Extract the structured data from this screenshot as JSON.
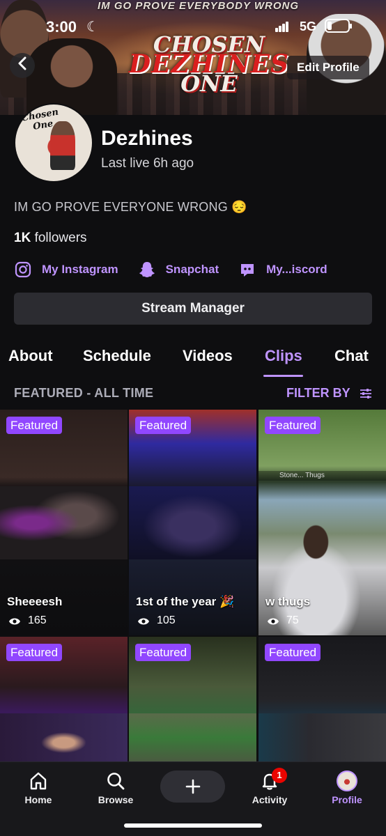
{
  "status_bar": {
    "time": "3:00",
    "network": "5G"
  },
  "banner": {
    "top_text": "IM GO PROVE EVERYBODY WRONG",
    "logo_line1": "CHOSEN",
    "logo_line2": "DEZHINES",
    "logo_line3": "ONE"
  },
  "header": {
    "edit_profile_label": "Edit Profile"
  },
  "profile": {
    "avatar_text_line1": "Chosen",
    "avatar_text_line2": "One",
    "username": "Dezhines",
    "last_live": "Last live 6h ago",
    "bio": "IM GO PROVE EVERYONE WRONG 😔",
    "followers_count": "1K",
    "followers_label": "followers"
  },
  "socials": [
    {
      "label": "My Instagram",
      "icon": "instagram-icon"
    },
    {
      "label": "Snapchat",
      "icon": "snapchat-icon"
    },
    {
      "label": "My...iscord",
      "icon": "discord-icon"
    }
  ],
  "stream_manager_label": "Stream Manager",
  "tabs": [
    {
      "label": "About",
      "active": false
    },
    {
      "label": "Schedule",
      "active": false
    },
    {
      "label": "Videos",
      "active": false
    },
    {
      "label": "Clips",
      "active": true
    },
    {
      "label": "Chat",
      "active": false
    }
  ],
  "clips_section": {
    "heading": "FEATURED - ALL TIME",
    "filter_label": "FILTER BY"
  },
  "clips": [
    {
      "badge": "Featured",
      "title": "Sheeeesh",
      "views": "165"
    },
    {
      "badge": "Featured",
      "title": "1st of the year 🎉",
      "views": "105"
    },
    {
      "badge": "Featured",
      "title": "w thugs",
      "views": "75",
      "overlay_text": "Stone...   Thugs"
    },
    {
      "badge": "Featured"
    },
    {
      "badge": "Featured"
    },
    {
      "badge": "Featured"
    }
  ],
  "bottom_nav": [
    {
      "label": "Home",
      "icon": "home-icon",
      "active": false
    },
    {
      "label": "Browse",
      "icon": "search-icon",
      "active": false
    },
    {
      "label": "",
      "icon": "plus-icon",
      "active": false
    },
    {
      "label": "Activity",
      "icon": "bell-icon",
      "active": false,
      "badge": "1"
    },
    {
      "label": "Profile",
      "icon": "avatar",
      "active": true
    }
  ],
  "colors": {
    "accent": "#bf94ff",
    "badge_purple": "#9147ff",
    "background": "#0e0e10",
    "notification_red": "#eb0400"
  }
}
